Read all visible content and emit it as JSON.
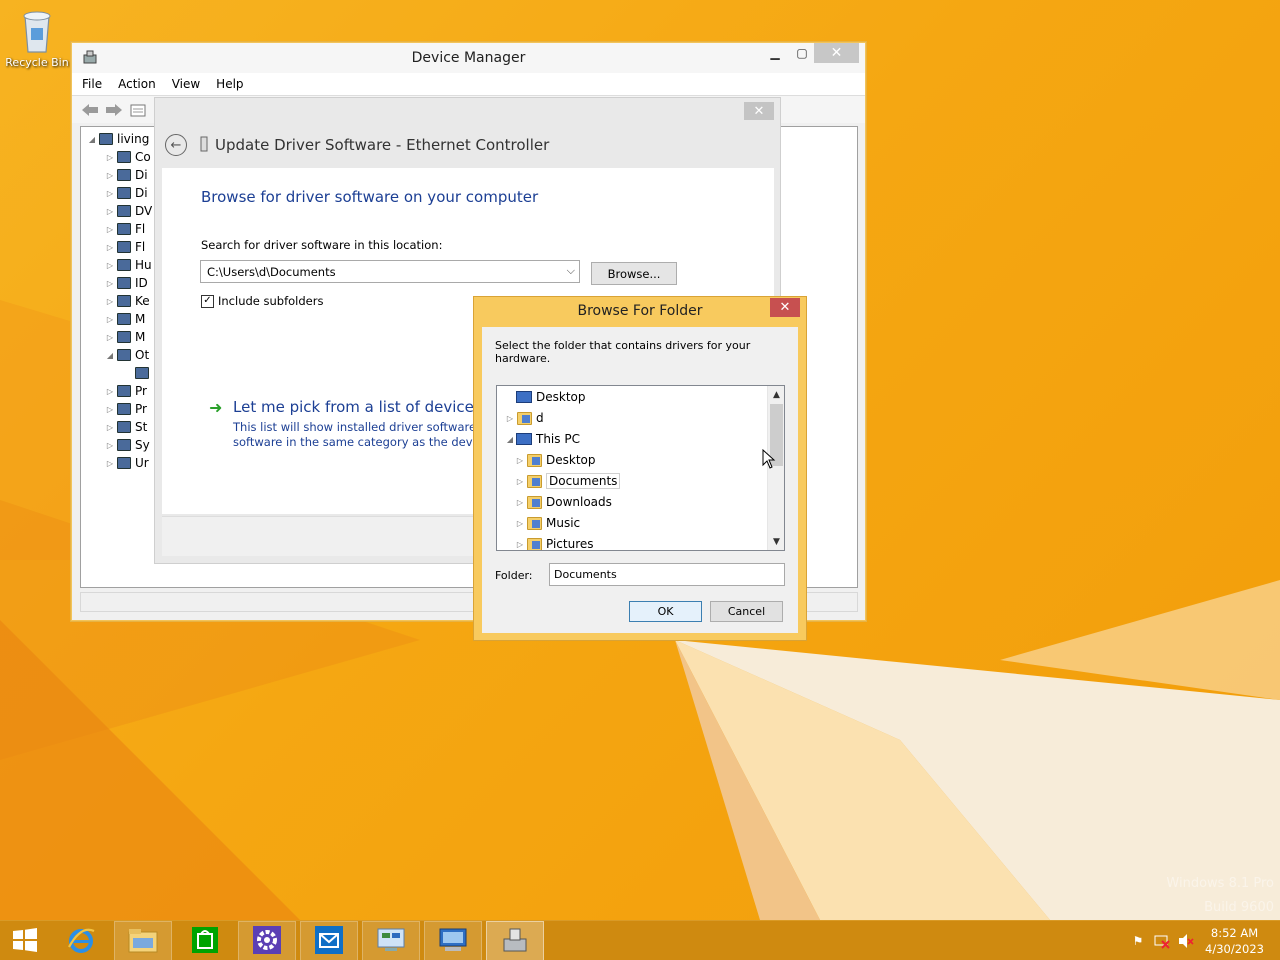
{
  "desktop": {
    "recycle_bin_label": "Recycle Bin",
    "watermark_line1": "Windows 8.1 Pro",
    "watermark_line2": "Build 9600"
  },
  "device_manager": {
    "title": "Device Manager",
    "menu": [
      "File",
      "Action",
      "View",
      "Help"
    ],
    "tree": [
      {
        "label": "living",
        "indent": 0,
        "expander": "◢",
        "icon": "computer-icon"
      },
      {
        "label": "Co",
        "indent": 1,
        "expander": "▷",
        "icon": "monitor-icon"
      },
      {
        "label": "Di",
        "indent": 1,
        "expander": "▷",
        "icon": "disk-icon"
      },
      {
        "label": "Di",
        "indent": 1,
        "expander": "▷",
        "icon": "display-icon"
      },
      {
        "label": "DV",
        "indent": 1,
        "expander": "▷",
        "icon": "dvd-icon"
      },
      {
        "label": "Fl",
        "indent": 1,
        "expander": "▷",
        "icon": "floppy-icon"
      },
      {
        "label": "Fl",
        "indent": 1,
        "expander": "▷",
        "icon": "floppy-icon"
      },
      {
        "label": "Hu",
        "indent": 1,
        "expander": "▷",
        "icon": "hid-icon"
      },
      {
        "label": "ID",
        "indent": 1,
        "expander": "▷",
        "icon": "ide-icon"
      },
      {
        "label": "Ke",
        "indent": 1,
        "expander": "▷",
        "icon": "keyboard-icon"
      },
      {
        "label": "M",
        "indent": 1,
        "expander": "▷",
        "icon": "mouse-icon"
      },
      {
        "label": "M",
        "indent": 1,
        "expander": "▷",
        "icon": "monitor-icon"
      },
      {
        "label": "Ot",
        "indent": 1,
        "expander": "◢",
        "icon": "other-devices-icon"
      },
      {
        "label": "",
        "indent": 2,
        "expander": "",
        "icon": "warning-device-icon"
      },
      {
        "label": "Pr",
        "indent": 1,
        "expander": "▷",
        "icon": "printer-icon"
      },
      {
        "label": "Pr",
        "indent": 1,
        "expander": "▷",
        "icon": "processor-icon"
      },
      {
        "label": "St",
        "indent": 1,
        "expander": "▷",
        "icon": "storage-icon"
      },
      {
        "label": "Sy",
        "indent": 1,
        "expander": "▷",
        "icon": "system-icon"
      },
      {
        "label": "Ur",
        "indent": 1,
        "expander": "▷",
        "icon": "usb-icon"
      }
    ]
  },
  "update_driver": {
    "title": "Update Driver Software - Ethernet Controller",
    "heading": "Browse for driver software on your computer",
    "search_label": "Search for driver software in this location:",
    "path_value": "C:\\Users\\d\\Documents",
    "browse_label": "Browse...",
    "include_subfolders_label": "Include subfolders",
    "include_subfolders_checked": true,
    "pick_title": "Let me pick from a list of device dri",
    "pick_desc_line1": "This list will show installed driver software cor",
    "pick_desc_line2": "software in the same category as the device."
  },
  "browse_folder": {
    "title": "Browse For Folder",
    "description": "Select the folder that contains drivers for your hardware.",
    "tree": [
      {
        "label": "Desktop",
        "indent": 0,
        "expander": "",
        "icon": "desktop-icon"
      },
      {
        "label": "d",
        "indent": 0,
        "expander": "▷",
        "icon": "user-folder-icon"
      },
      {
        "label": "This PC",
        "indent": 0,
        "expander": "◢",
        "icon": "this-pc-icon"
      },
      {
        "label": "Desktop",
        "indent": 1,
        "expander": "▷",
        "icon": "desktop-folder-icon"
      },
      {
        "label": "Documents",
        "indent": 1,
        "expander": "▷",
        "icon": "documents-folder-icon",
        "selected": true
      },
      {
        "label": "Downloads",
        "indent": 1,
        "expander": "▷",
        "icon": "downloads-folder-icon"
      },
      {
        "label": "Music",
        "indent": 1,
        "expander": "▷",
        "icon": "music-folder-icon"
      },
      {
        "label": "Pictures",
        "indent": 1,
        "expander": "▷",
        "icon": "pictures-folder-icon"
      }
    ],
    "folder_label": "Folder:",
    "folder_value": "Documents",
    "ok_label": "OK",
    "cancel_label": "Cancel"
  },
  "taskbar": {
    "apps": [
      {
        "name": "start-button",
        "icon": "windows-logo-icon"
      },
      {
        "name": "internet-explorer",
        "icon": "ie-icon"
      },
      {
        "name": "file-explorer",
        "icon": "folder-icon"
      },
      {
        "name": "store",
        "icon": "store-icon"
      },
      {
        "name": "settings",
        "icon": "gear-icon"
      },
      {
        "name": "mail",
        "icon": "mail-icon"
      },
      {
        "name": "control-panel",
        "icon": "control-panel-icon"
      },
      {
        "name": "remote-desktop",
        "icon": "remote-desktop-icon"
      },
      {
        "name": "device-manager",
        "icon": "device-manager-icon"
      }
    ],
    "time": "8:52 AM",
    "date": "4/30/2023"
  },
  "colors": {
    "accent_link": "#1c3f94",
    "dialog_frame": "#f8ca5e",
    "close_red": "#c75050",
    "taskbar": "#cf8a10"
  }
}
